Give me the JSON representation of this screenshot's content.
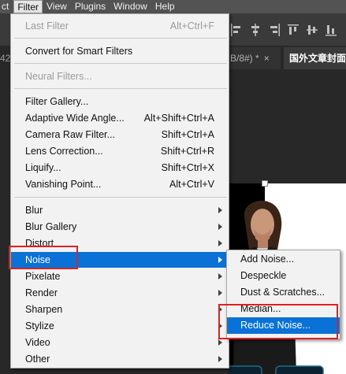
{
  "menubar": {
    "items": [
      {
        "label": "ct",
        "active": false
      },
      {
        "label": "Filter",
        "active": true
      },
      {
        "label": "View",
        "active": false
      },
      {
        "label": "Plugins",
        "active": false
      },
      {
        "label": "Window",
        "active": false
      },
      {
        "label": "Help",
        "active": false
      }
    ]
  },
  "tabs": {
    "partial_left": "42",
    "doc2": "B/8#) *",
    "doc2_close": "×",
    "doc3": "国外文章封面"
  },
  "filter_menu": {
    "last_filter": {
      "label": "Last Filter",
      "shortcut": "Alt+Ctrl+F"
    },
    "convert_smart": {
      "label": "Convert for Smart Filters"
    },
    "neural_filters": {
      "label": "Neural Filters..."
    },
    "filter_gallery": {
      "label": "Filter Gallery..."
    },
    "adaptive_wide": {
      "label": "Adaptive Wide Angle...",
      "shortcut": "Alt+Shift+Ctrl+A"
    },
    "camera_raw": {
      "label": "Camera Raw Filter...",
      "shortcut": "Shift+Ctrl+A"
    },
    "lens_correction": {
      "label": "Lens Correction...",
      "shortcut": "Shift+Ctrl+R"
    },
    "liquify": {
      "label": "Liquify...",
      "shortcut": "Shift+Ctrl+X"
    },
    "vanishing_point": {
      "label": "Vanishing Point...",
      "shortcut": "Alt+Ctrl+V"
    },
    "submenus": [
      "Blur",
      "Blur Gallery",
      "Distort",
      "Noise",
      "Pixelate",
      "Render",
      "Sharpen",
      "Stylize",
      "Video",
      "Other"
    ]
  },
  "noise_submenu": {
    "items": [
      "Add Noise...",
      "Despeckle",
      "Dust & Scratches...",
      "Median...",
      "Reduce Noise..."
    ],
    "selected": "Reduce Noise..."
  },
  "colors": {
    "highlight": "#0a72d6",
    "annotation_red": "#e02020",
    "menu_bg": "#f2f2f2"
  }
}
